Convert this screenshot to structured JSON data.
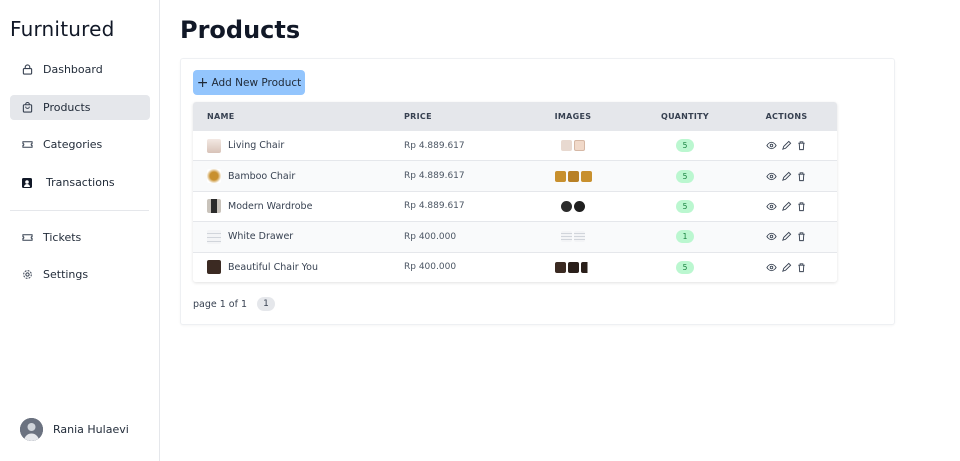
{
  "brand": "Furnitured",
  "sidebar": {
    "items": [
      {
        "label": "Dashboard",
        "icon": "lock-icon"
      },
      {
        "label": "Products",
        "icon": "bag-icon"
      },
      {
        "label": "Categories",
        "icon": "ticket-icon"
      },
      {
        "label": "Transactions",
        "icon": "contact-icon"
      },
      {
        "label": "Tickets",
        "icon": "ticket-icon"
      },
      {
        "label": "Settings",
        "icon": "gear-icon"
      }
    ],
    "active": "Products",
    "user": {
      "name": "Rania Hulaevi"
    }
  },
  "main": {
    "title": "Products",
    "add_button": "Add New Product",
    "columns": [
      "NAME",
      "PRICE",
      "IMAGES",
      "QUANTITY",
      "ACTIONS"
    ],
    "rows": [
      {
        "name": "Living Chair",
        "price": "Rp 4.889.617",
        "quantity": "5"
      },
      {
        "name": "Bamboo Chair",
        "price": "Rp 4.889.617",
        "quantity": "5"
      },
      {
        "name": "Modern Wardrobe",
        "price": "Rp 4.889.617",
        "quantity": "5"
      },
      {
        "name": "White Drawer",
        "price": "Rp 400.000",
        "quantity": "1"
      },
      {
        "name": "Beautiful Chair You",
        "price": "Rp 400.000",
        "quantity": "5"
      }
    ],
    "pagination": {
      "text": "page 1 of 1",
      "current": "1"
    }
  },
  "colors": {
    "accent": "#93c5fd",
    "active_nav": "#e5e7eb",
    "badge_bg": "#bbf7d0",
    "badge_text": "#15803d"
  }
}
